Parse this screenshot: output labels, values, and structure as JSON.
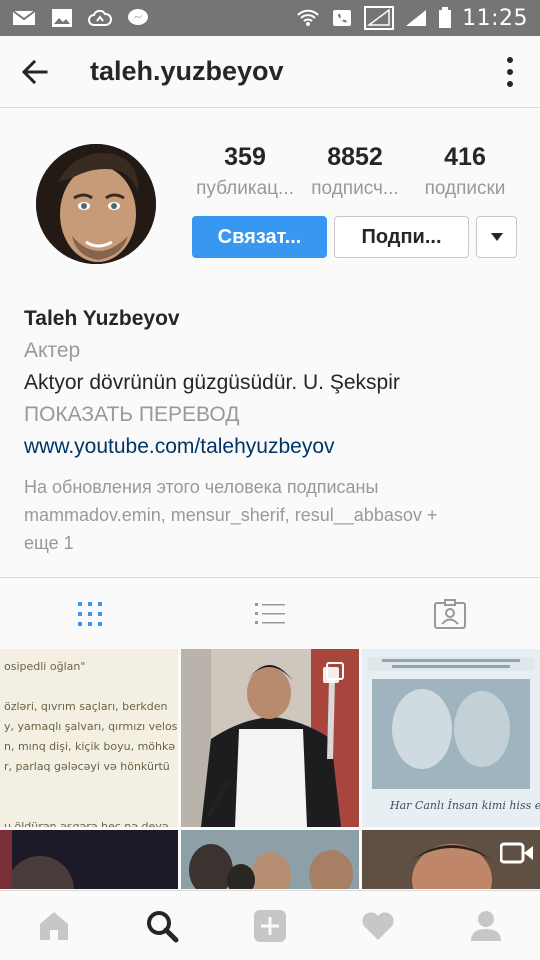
{
  "status_bar": {
    "time": "11:25",
    "icons": [
      "mail-icon",
      "image-icon",
      "cloud-icon",
      "messenger-icon",
      "wifi-icon",
      "call-icon",
      "no-signal-icon",
      "signal-icon",
      "battery-icon"
    ]
  },
  "header": {
    "username": "taleh.yuzbeyov",
    "back_icon": "arrow-left-icon",
    "more_icon": "more-vertical-icon"
  },
  "stats": [
    {
      "value": "359",
      "label": "публикац..."
    },
    {
      "value": "8852",
      "label": "подписч..."
    },
    {
      "value": "416",
      "label": "подписки"
    }
  ],
  "actions": {
    "contact": "Связат...",
    "following": "Подпи...",
    "dropdown_icon": "caret-down-icon"
  },
  "bio": {
    "name": "Taleh Yuzbeyov",
    "category": "Актер",
    "text": "Aktyor dövrünün güzgüsüdür. U. Şekspir",
    "translate": "ПОКАЗАТЬ ПЕРЕВОД",
    "link": "www.youtube.com/talehyuzbeyov",
    "followed_by_line1": "На обновления этого человека подписаны",
    "followed_by_line2": "mammadov.emin, mensur_sherif, resul__abbasov +",
    "followed_by_line3": "еще 1"
  },
  "tabs": [
    "grid-icon",
    "list-icon",
    "tagged-icon"
  ],
  "posts": {
    "post1_lines": [
      "osipedli oğlan\"",
      "",
      "özləri, qıvrım saçları, berkden",
      "y, yamaqlı şalvarı, qırmızı velos",
      "n, mınq dişi, kiçik boyu, möhkə",
      "r, parlaq gələcəyi və hönkürtü",
      "",
      "",
      "u öldürən əsgərə heç nə deyə"
    ],
    "post3_caption": "Har Canlı İnsan kimi hiss edir."
  },
  "bottom_nav": [
    "home-icon",
    "search-icon",
    "add-icon",
    "heart-icon",
    "profile-icon"
  ],
  "colors": {
    "accent": "#3897f0",
    "link": "#003569",
    "status_bar": "#757575"
  }
}
